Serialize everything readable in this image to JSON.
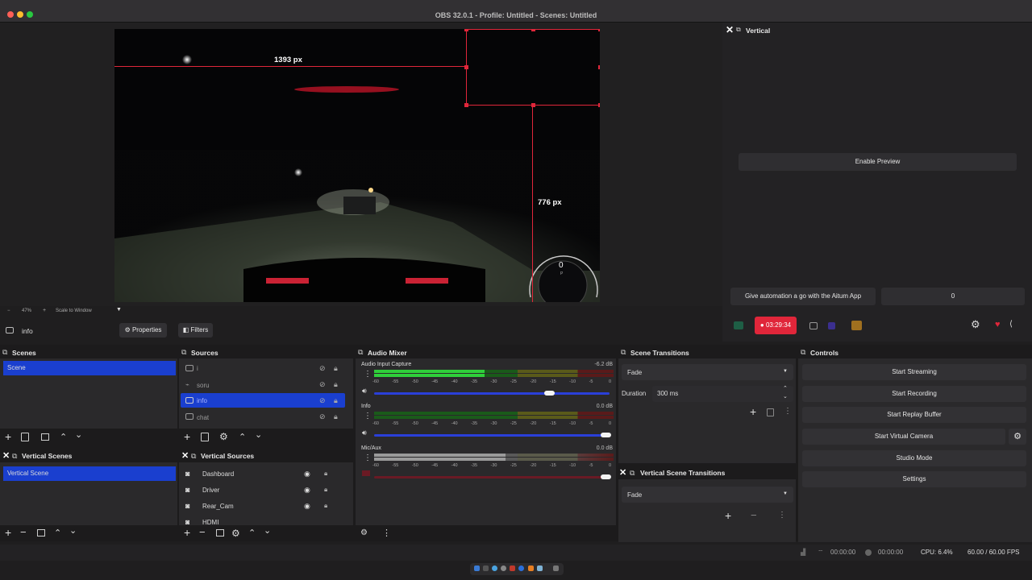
{
  "window": {
    "title": "OBS 32.0.1 - Profile: Untitled - Scenes: Untitled"
  },
  "canvas": {
    "width_label": "1393 px",
    "height_label": "776 px",
    "zoom": "47%",
    "scale_mode": "Scale to Window",
    "speed_digit": "0",
    "gear": "P"
  },
  "source_toolbar": {
    "name": "info",
    "properties": "Properties",
    "filters": "Filters"
  },
  "vertical": {
    "title": "Vertical",
    "enable_preview": "Enable Preview",
    "aitum_msg": "Give automation a go with the Aitum App",
    "aitum_btn": "0",
    "rec_time": "03:29:34"
  },
  "scenes": {
    "title": "Scenes",
    "items": [
      "Scene"
    ]
  },
  "sources": {
    "title": "Sources",
    "items": [
      "i",
      "soru",
      "info",
      "chat"
    ]
  },
  "vertical_scenes": {
    "title": "Vertical Scenes",
    "items": [
      "Vertical Scene"
    ]
  },
  "vertical_sources": {
    "title": "Vertical Sources",
    "items": [
      "Dashboard",
      "Driver",
      "Rear_Cam",
      "HDMI"
    ]
  },
  "mixer": {
    "title": "Audio Mixer",
    "channels": [
      {
        "name": "Audio Input Capture",
        "db": "-6.2 dB",
        "level": 0.75
      },
      {
        "name": "Info",
        "db": "0.0 dB",
        "level": 1.0
      },
      {
        "name": "Mic/Aux",
        "db": "0.0 dB",
        "level": 1.0
      }
    ],
    "ticks": [
      "-60",
      "-55",
      "-50",
      "-45",
      "-40",
      "-35",
      "-30",
      "-25",
      "-20",
      "-15",
      "-10",
      "-5",
      "0"
    ]
  },
  "transitions": {
    "title": "Scene Transitions",
    "value": "Fade",
    "duration_label": "Duration",
    "duration": "300 ms"
  },
  "vertical_transitions": {
    "title": "Vertical Scene Transitions",
    "value": "Fade"
  },
  "controls": {
    "title": "Controls",
    "buttons": [
      "Start Streaming",
      "Start Recording",
      "Start Replay Buffer",
      "Start Virtual Camera",
      "Studio Mode",
      "Settings"
    ]
  },
  "status": {
    "stream_time": "00:00:00",
    "rec_time": "00:00:00",
    "cpu": "CPU: 6.4%",
    "fps": "60.00 / 60.00 FPS"
  },
  "colors": {
    "accent": "#1a3fcf",
    "record": "#e0263a",
    "green": "#2db52d",
    "yellow": "#b5a62d",
    "red": "#b52d2d"
  }
}
